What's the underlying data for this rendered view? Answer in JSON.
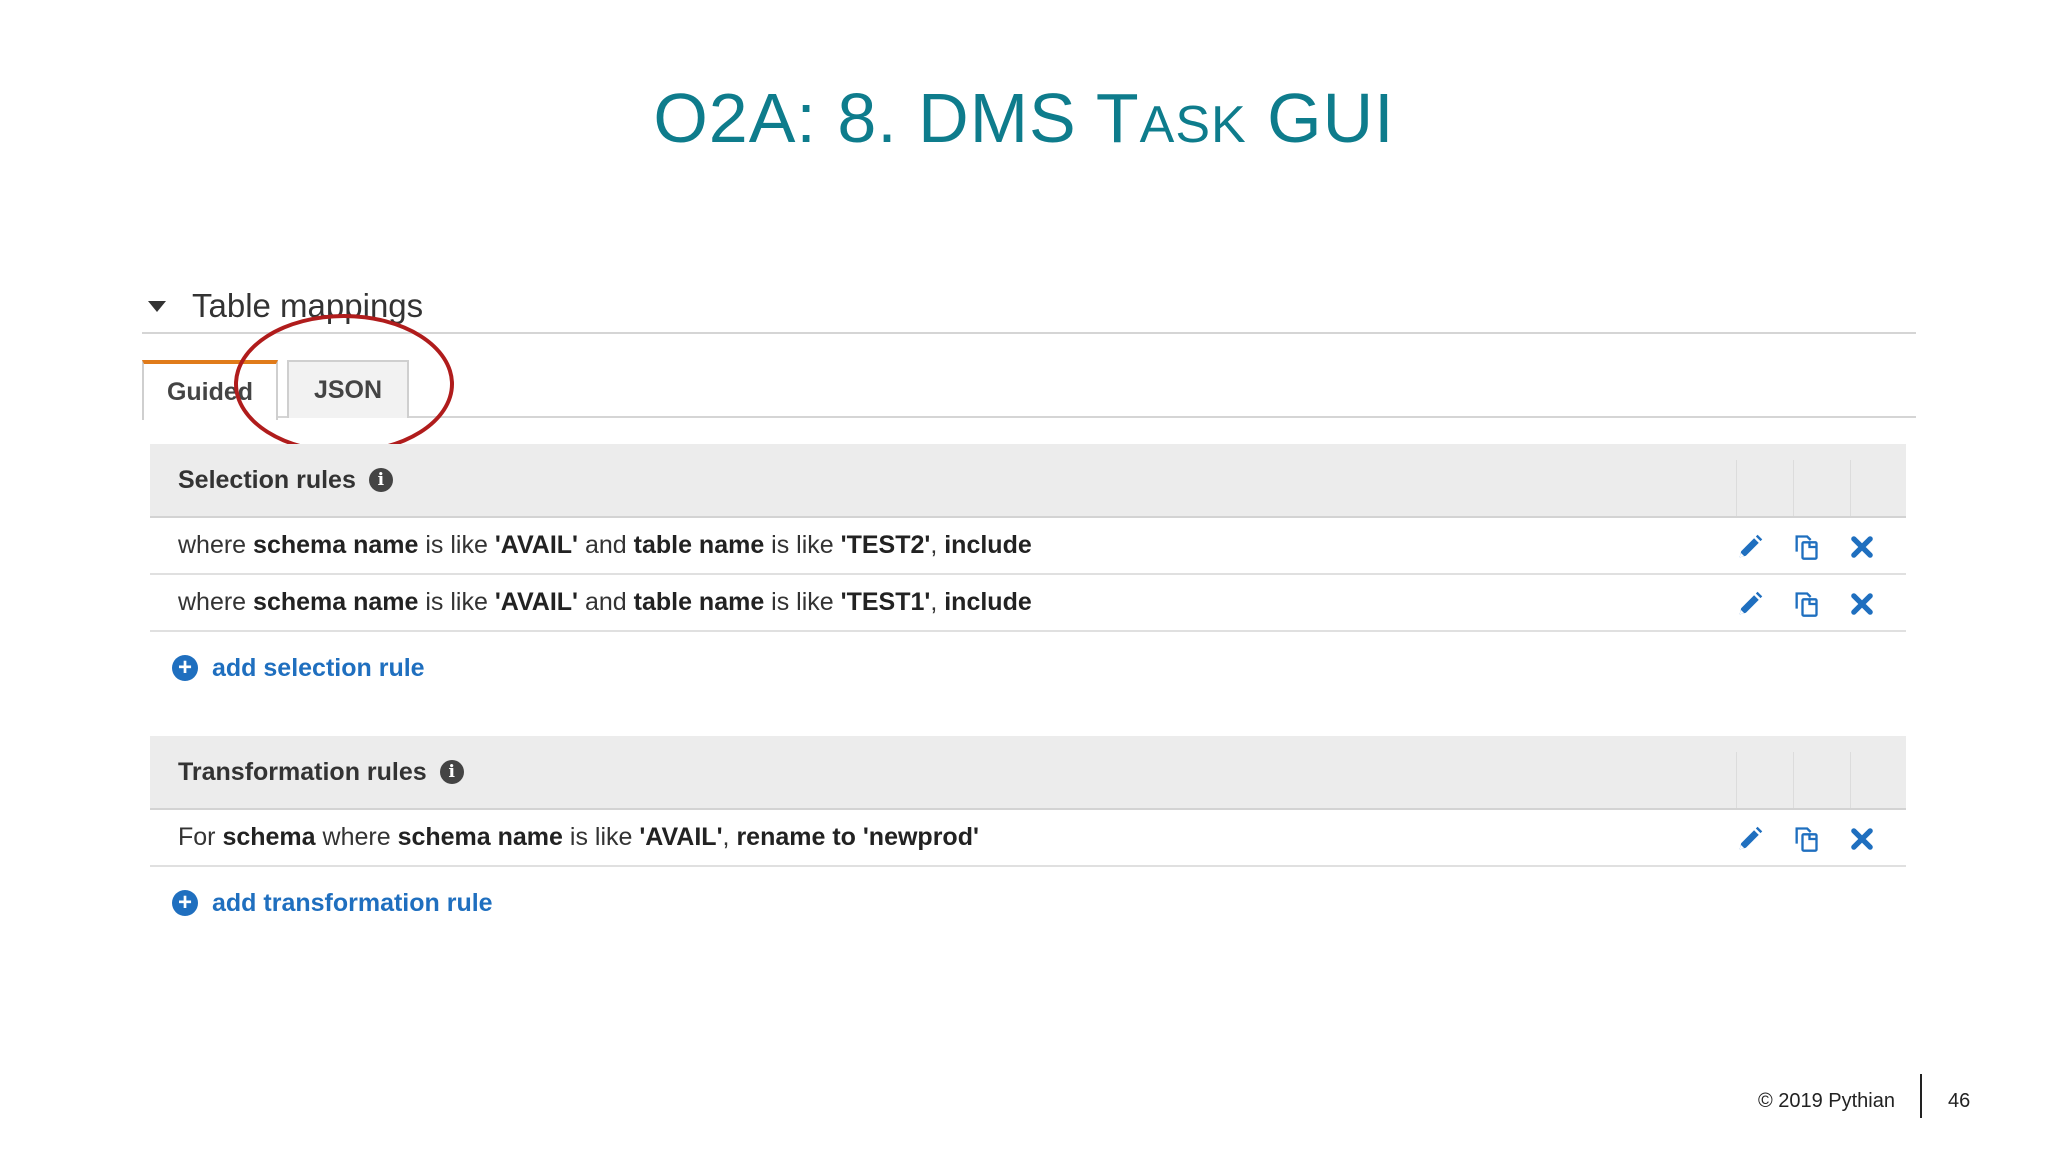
{
  "slide": {
    "title_prefix": "O2A: 8. DMS T",
    "title_smallcaps": "ASK",
    "title_suffix": " GUI"
  },
  "section": {
    "title": "Table mappings"
  },
  "tabs": [
    {
      "label": "Guided",
      "active": true
    },
    {
      "label": "JSON",
      "active": false
    }
  ],
  "selection_rules": {
    "header": "Selection rules",
    "rows": [
      {
        "p1": "where ",
        "b1": "schema name",
        "p2": " is like ",
        "b2": "'AVAIL'",
        "p3": " and ",
        "b3": "table name",
        "p4": " is like ",
        "b4": "'TEST2'",
        "p5": ", ",
        "b5": "include"
      },
      {
        "p1": "where ",
        "b1": "schema name",
        "p2": " is like ",
        "b2": "'AVAIL'",
        "p3": " and ",
        "b3": "table name",
        "p4": " is like ",
        "b4": "'TEST1'",
        "p5": ", ",
        "b5": "include"
      }
    ],
    "add_label": "add selection rule"
  },
  "transformation_rules": {
    "header": "Transformation rules",
    "rows": [
      {
        "p1": "For ",
        "b1": "schema",
        "p2": " where ",
        "b2": "schema name",
        "p3": " is like ",
        "b3": "'AVAIL'",
        "p4": ", ",
        "b4": "rename to 'newprod'"
      }
    ],
    "add_label": "add transformation rule"
  },
  "footer": {
    "copyright": "© 2019 Pythian",
    "page": "46"
  },
  "colors": {
    "title": "#0e7c8c",
    "link": "#1f6fbf",
    "tab_accent": "#e07b1a",
    "highlight": "#b01c1c"
  },
  "icons": [
    "caret-down-icon",
    "info-icon",
    "pencil-icon",
    "copy-icon",
    "close-icon",
    "plus-circle-icon"
  ]
}
